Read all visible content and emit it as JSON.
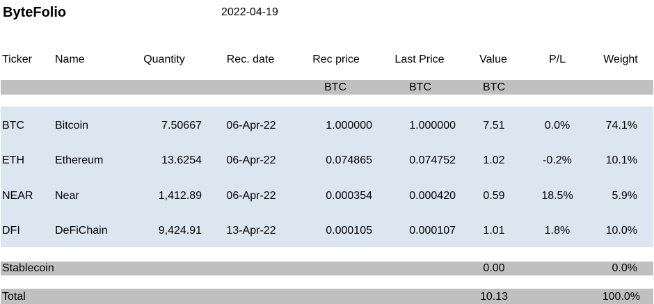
{
  "app": {
    "title": "ByteFolio",
    "date": "2022-04-19"
  },
  "columns": {
    "ticker": "Ticker",
    "name": "Name",
    "quantity": "Quantity",
    "rec_date": "Rec. date",
    "rec_price": "Rec price",
    "last_price": "Last Price",
    "value": "Value",
    "pl": "P/L",
    "weight": "Weight"
  },
  "units": {
    "rec_price": "BTC",
    "last_price": "BTC",
    "value": "BTC"
  },
  "holdings": [
    {
      "ticker": "BTC",
      "name": "Bitcoin",
      "quantity": "7.50667",
      "rec_date": "06-Apr-22",
      "rec_price": "1.000000",
      "last_price": "1.000000",
      "value": "7.51",
      "pl": "0.0%",
      "weight": "74.1%"
    },
    {
      "ticker": "ETH",
      "name": "Ethereum",
      "quantity": "13.6254",
      "rec_date": "06-Apr-22",
      "rec_price": "0.074865",
      "last_price": "0.074752",
      "value": "1.02",
      "pl": "-0.2%",
      "weight": "10.1%"
    },
    {
      "ticker": "NEAR",
      "name": "Near",
      "quantity": "1,412.89",
      "rec_date": "06-Apr-22",
      "rec_price": "0.000354",
      "last_price": "0.000420",
      "value": "0.59",
      "pl": "18.5%",
      "weight": "5.9%"
    },
    {
      "ticker": "DFI",
      "name": "DeFiChain",
      "quantity": "9,424.91",
      "rec_date": "13-Apr-22",
      "rec_price": "0.000105",
      "last_price": "0.000107",
      "value": "1.01",
      "pl": "1.8%",
      "weight": "10.0%"
    }
  ],
  "stablecoin": {
    "label": "Stablecoin",
    "value": "0.00",
    "weight": "0.0%"
  },
  "total": {
    "label": "Total",
    "value": "10.13",
    "weight": "100.0%"
  }
}
